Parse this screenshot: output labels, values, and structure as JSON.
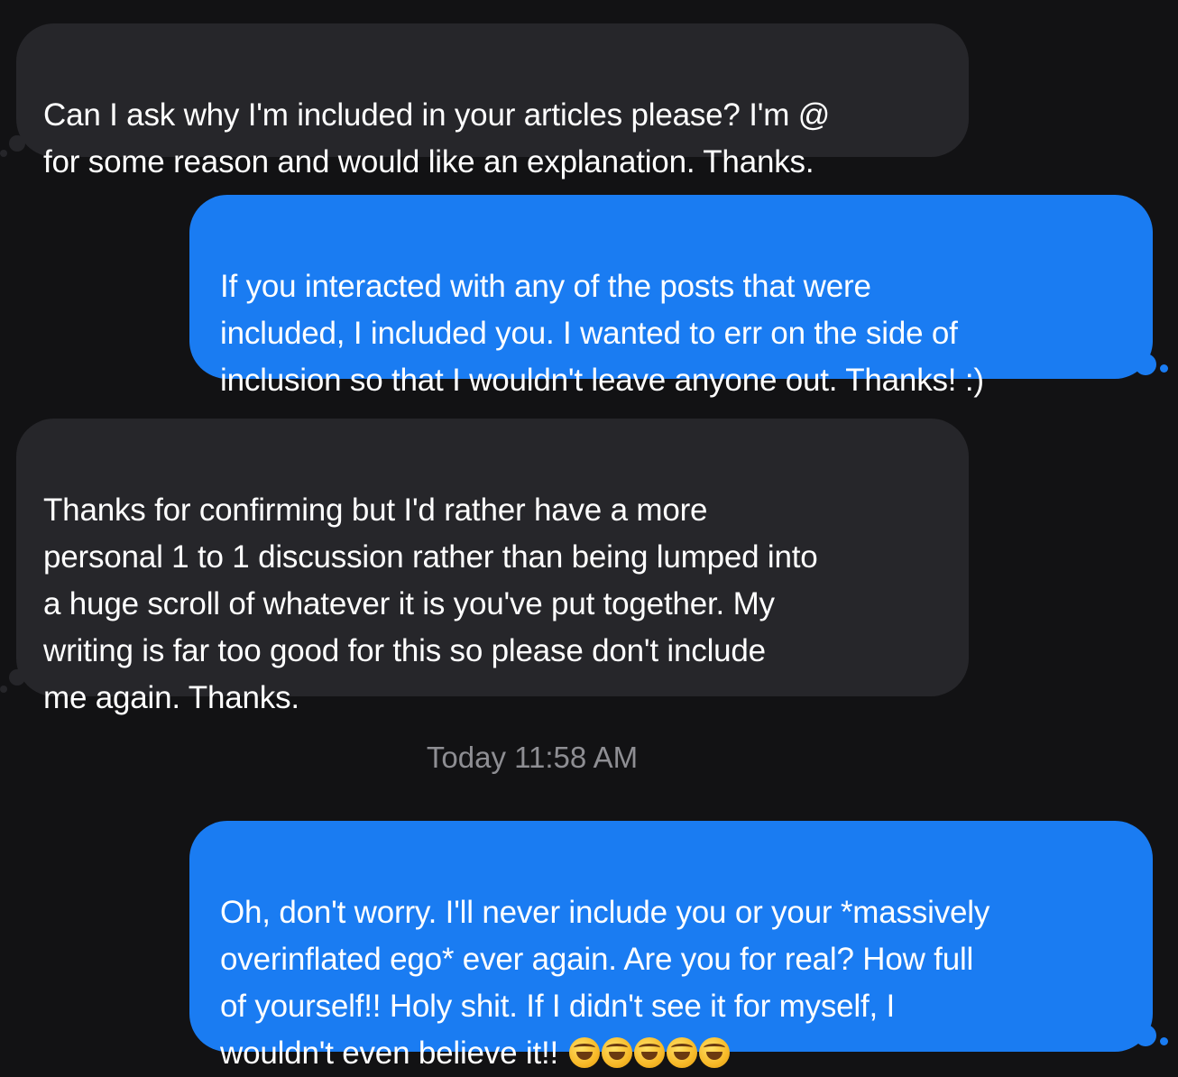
{
  "messages": [
    {
      "direction": "incoming",
      "text": "Can I ask why I'm included in your articles please? I'm @\nfor some reason and would like an explanation. Thanks."
    },
    {
      "direction": "outgoing",
      "text": "If you interacted with any of the posts that were\nincluded, I included you. I wanted to err on the side of\ninclusion so that I wouldn't leave anyone out. Thanks! :)"
    },
    {
      "direction": "incoming",
      "text": "Thanks for confirming but I'd rather have a more\npersonal 1 to 1 discussion rather than being lumped into\na huge scroll of whatever it is you've put together. My\nwriting is far too good for this so please don't include\nme again. Thanks."
    },
    {
      "direction": "outgoing",
      "text": "Oh, don't worry. I'll never include you or your *massively\noverinflated ego* ever again. Are you for real? How full\nof yourself!! Holy shit. If I didn't see it for myself, I\nwouldn't even believe it!! ",
      "emoji_name": "rolling-on-floor-laughing-emoji",
      "emoji_count": 5
    }
  ],
  "timestamp": "Today 11:58 AM",
  "colors": {
    "background": "#121214",
    "incoming_bubble": "#26262a",
    "outgoing_bubble": "#1a7cf2",
    "timestamp_text": "#8e8e93"
  }
}
